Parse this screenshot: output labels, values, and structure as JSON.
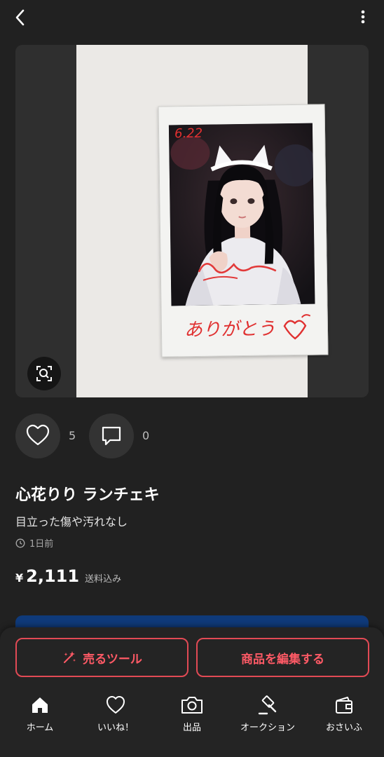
{
  "product": {
    "title": "心花りり ランチェキ",
    "condition": "目立った傷や汚れなし",
    "posted": "1日前",
    "currency": "¥",
    "price": "2,111",
    "shipping": "送料込み",
    "likes": "5",
    "comments": "0"
  },
  "buttons": {
    "sell_tool": "売るツール",
    "edit_item": "商品を編集する"
  },
  "nav": [
    {
      "label": "ホーム",
      "icon": "home-icon"
    },
    {
      "label": "いいね！",
      "icon": "heart-icon"
    },
    {
      "label": "出品",
      "icon": "camera-icon"
    },
    {
      "label": "オークション",
      "icon": "gavel-icon"
    },
    {
      "label": "おさいふ",
      "icon": "wallet-icon"
    }
  ],
  "colors": {
    "background": "#212121",
    "accent": "#e24a55",
    "banner": "#0f3a7a"
  },
  "photo_inscriptions": [
    "6.22",
    "ありがとう"
  ]
}
